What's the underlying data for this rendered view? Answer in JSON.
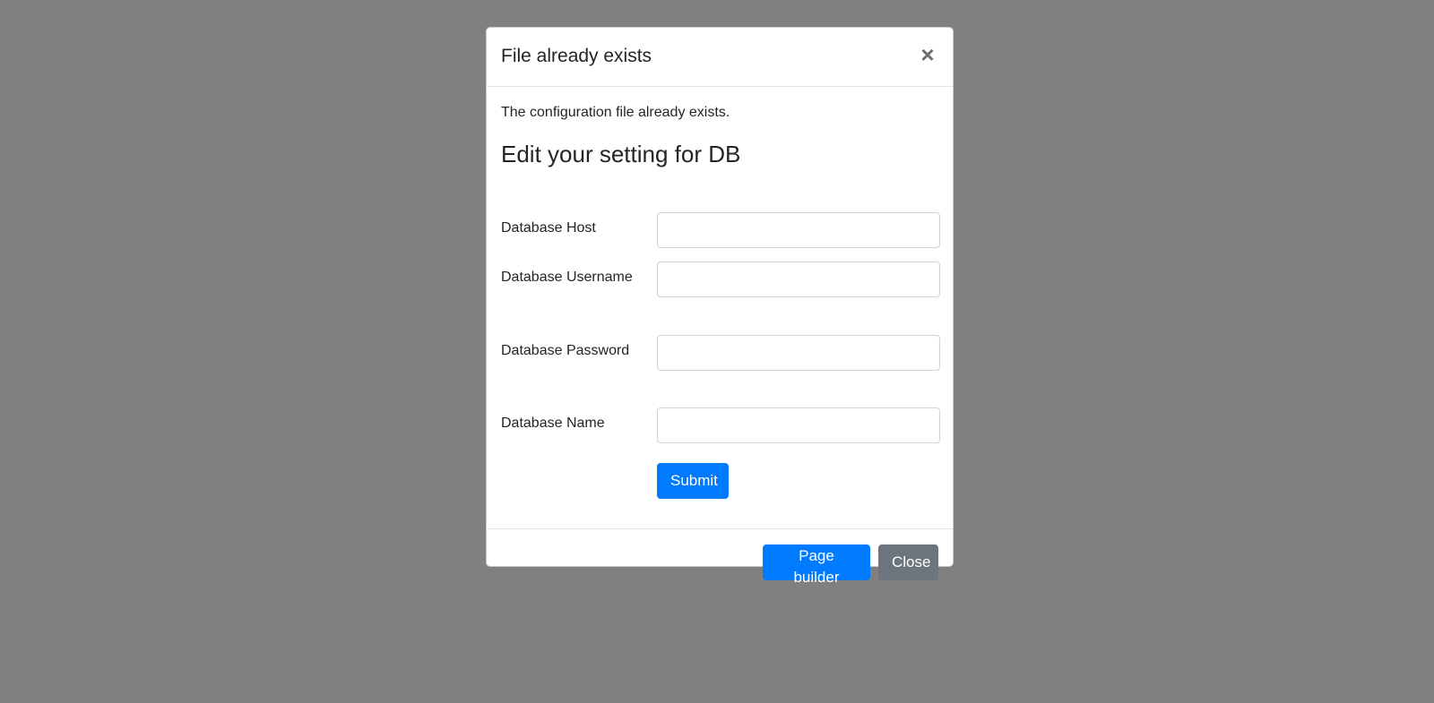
{
  "modal": {
    "title": "File already exists",
    "close_icon": "×",
    "intro": "The configuration file already exists.",
    "section_heading": "Edit your setting for DB",
    "fields": [
      {
        "label": "Database Host",
        "value": "",
        "placeholder": ""
      },
      {
        "label": "Database Username",
        "value": "",
        "placeholder": ""
      },
      {
        "label": "Database Password",
        "value": "",
        "placeholder": ""
      },
      {
        "label": "Database Name",
        "value": "",
        "placeholder": ""
      }
    ],
    "submit_label": "Submit",
    "footer": {
      "page_builder_label": "Page builder",
      "close_label": "Close"
    }
  },
  "colors": {
    "backdrop": "#808080",
    "primary": "#007bff",
    "secondary": "#6c757d"
  }
}
